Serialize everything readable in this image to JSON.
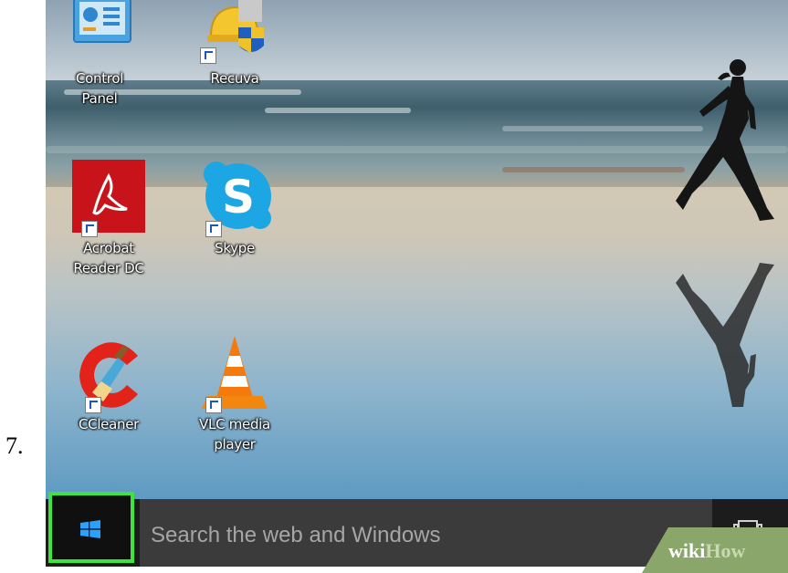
{
  "step": {
    "number": "7."
  },
  "desktop": {
    "icons": [
      {
        "name": "control-panel",
        "label_line1": "Control",
        "label_line2": "Panel"
      },
      {
        "name": "recuva",
        "label_line1": "Recuva",
        "label_line2": ""
      },
      {
        "name": "acrobat",
        "label_line1": "Acrobat",
        "label_line2": "Reader DC"
      },
      {
        "name": "skype",
        "label_line1": "Skype",
        "label_line2": ""
      },
      {
        "name": "ccleaner",
        "label_line1": "CCleaner",
        "label_line2": ""
      },
      {
        "name": "vlc",
        "label_line1": "VLC media",
        "label_line2": "player"
      }
    ]
  },
  "taskbar": {
    "search_placeholder": "Search the web and Windows",
    "highlight_color": "#3ee43e"
  },
  "watermark": {
    "part1": "wiki",
    "part2": "How"
  }
}
